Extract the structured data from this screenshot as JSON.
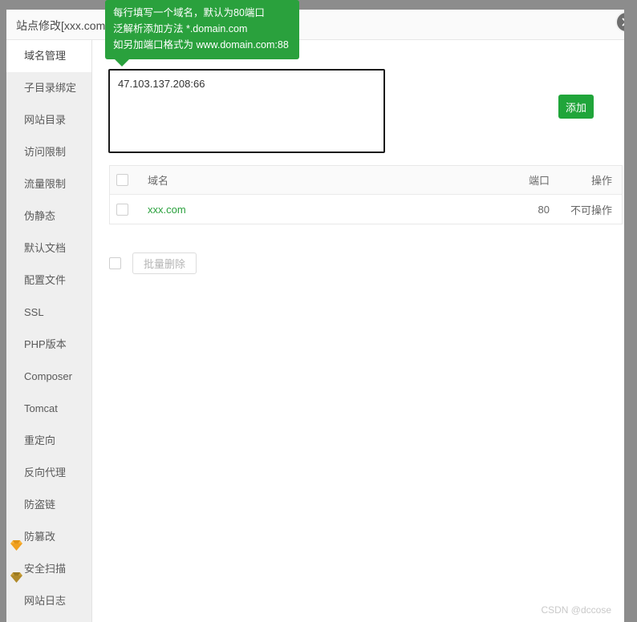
{
  "window": {
    "title": "站点修改[xxx.com]",
    "close_icon": "close-circle-icon"
  },
  "colors": {
    "accent_green": "#2aa13d",
    "button_green": "#20a53a",
    "sidebar_bg": "#efefef",
    "overlay": "#8c8c8c",
    "gem_orange": "#f0a020",
    "gem_gold": "#b08a2a",
    "link_green": "#2aa13d"
  },
  "tooltip": {
    "lines": [
      "每行填写一个域名，默认为80端口",
      "泛解析添加方法 *.domain.com",
      "如另加端口格式为 www.domain.com:88"
    ]
  },
  "sidebar": {
    "items": [
      {
        "label": "域名管理",
        "active": true,
        "icon": ""
      },
      {
        "label": "子目录绑定",
        "active": false,
        "icon": ""
      },
      {
        "label": "网站目录",
        "active": false,
        "icon": ""
      },
      {
        "label": "访问限制",
        "active": false,
        "icon": ""
      },
      {
        "label": "流量限制",
        "active": false,
        "icon": ""
      },
      {
        "label": "伪静态",
        "active": false,
        "icon": ""
      },
      {
        "label": "默认文档",
        "active": false,
        "icon": ""
      },
      {
        "label": "配置文件",
        "active": false,
        "icon": ""
      },
      {
        "label": "SSL",
        "active": false,
        "icon": ""
      },
      {
        "label": "PHP版本",
        "active": false,
        "icon": ""
      },
      {
        "label": "Composer",
        "active": false,
        "icon": ""
      },
      {
        "label": "Tomcat",
        "active": false,
        "icon": ""
      },
      {
        "label": "重定向",
        "active": false,
        "icon": ""
      },
      {
        "label": "反向代理",
        "active": false,
        "icon": ""
      },
      {
        "label": "防盗链",
        "active": false,
        "icon": ""
      },
      {
        "label": "防篡改",
        "active": false,
        "icon": "gem-orange-icon"
      },
      {
        "label": "安全扫描",
        "active": false,
        "icon": "gem-gold-icon"
      },
      {
        "label": "网站日志",
        "active": false,
        "icon": ""
      }
    ]
  },
  "main": {
    "domain_input": {
      "value": "47.103.137.208:66",
      "placeholder": ""
    },
    "add_button": "添加",
    "table": {
      "headers": [
        "域名",
        "端口",
        "操作"
      ],
      "rows": [
        {
          "domain": "xxx.com",
          "port": "80",
          "op": "不可操作"
        }
      ]
    },
    "bulk_delete_button": "批量删除"
  },
  "watermark": "CSDN @dccose"
}
